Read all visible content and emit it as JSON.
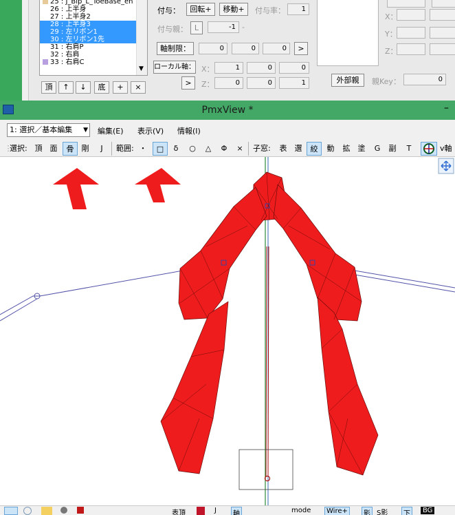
{
  "bone_list": {
    "items": [
      {
        "label": "25 : J_Bip_L_ToeBase_en",
        "color": "#e8c99a",
        "selected": false
      },
      {
        "label": "26 : 上半身",
        "color": "#ffffff",
        "selected": false
      },
      {
        "label": "27 : 上半身2",
        "color": "#ffffff",
        "selected": false
      },
      {
        "label": "28 : 上半身3",
        "color": "#3399ff",
        "selected": true
      },
      {
        "label": "29 : 左リボン1",
        "color": "#3399ff",
        "selected": true
      },
      {
        "label": "30 : 左リボン1先",
        "color": "#3399ff",
        "selected": true
      },
      {
        "label": "31 : 右肩P",
        "color": "#ffffff",
        "selected": false
      },
      {
        "label": "32 : 右肩",
        "color": "#ffffff",
        "selected": false
      },
      {
        "label": "33 : 右肩C",
        "color": "#b8a0e0",
        "selected": false
      }
    ],
    "buttons": {
      "top": "頂",
      "up": "↑",
      "down": "↓",
      "bottom": "底",
      "add": "+",
      "delete": "×"
    }
  },
  "bone_props": {
    "grant_label": "付与：",
    "rotate_btn": "回転+",
    "move_btn": "移動+",
    "grant_rate_label": "付与率：",
    "grant_rate_value": "1",
    "grant_parent_label": "付与親：",
    "grant_parent_btn": "L",
    "grant_parent_value": "-1",
    "grant_parent_dash": "-",
    "axis_limit_btn": "軸制限：",
    "axis_limit": [
      "0",
      "0",
      "0"
    ],
    "local_axis_btn": "ローカル軸：",
    "local_x_label": "X：",
    "local_x": [
      "1",
      "0",
      "0"
    ],
    "local_z_label": "Z：",
    "local_z": [
      "0",
      "0",
      "1"
    ],
    "arrow_btn": ">",
    "external_parent_btn": "外部親",
    "parent_key_label": "親Key：",
    "parent_key_value": "0",
    "right_x": "X：",
    "right_y": "Y：",
    "right_z": "Z："
  },
  "window": {
    "title": "PmxView *",
    "minimize": "–"
  },
  "menubar": {
    "mode": "1: 選択／基本編集",
    "edit": "編集(E)",
    "view": "表示(V)",
    "info": "情報(I)"
  },
  "toolbar": {
    "select_label": "選択:",
    "vertex": "頂",
    "face": "面",
    "bone": "骨",
    "rigid": "剛",
    "joint": "J",
    "range_label": "範囲:",
    "r_dot": "・",
    "r_rect": "□",
    "r_delta": "δ",
    "r_circle": "○",
    "r_tri": "△",
    "r_phi": "Φ",
    "r_x": "×",
    "child_label": "子窓:",
    "c_table": "表",
    "c_select": "選",
    "c_narrow": "絞",
    "c_move": "動",
    "c_scale": "拡",
    "c_paint": "塗",
    "c_g": "G",
    "c_sub": "副",
    "c_t": "T",
    "axis_v": "v軸"
  },
  "statusbar": {
    "top": "表頂",
    "j": "J",
    "axis": "軸",
    "mode": "mode",
    "wire": "Wire+",
    "shadow": "影",
    "s_shadow": "S影",
    "bottom": "下",
    "bg": "BG"
  },
  "colors": {
    "accent_select": "#3399ff",
    "title_green": "#43a866",
    "model_red": "#ee1c1c",
    "bone_blue": "#4040a0",
    "arrow_red": "#ee1c1c"
  }
}
